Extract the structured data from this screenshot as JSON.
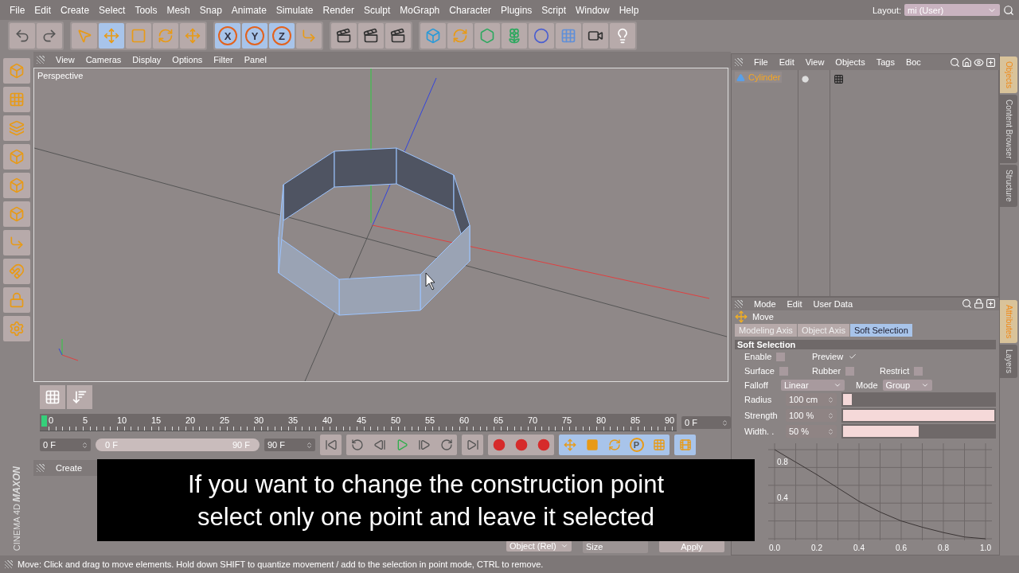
{
  "menu": [
    "File",
    "Edit",
    "Create",
    "Select",
    "Tools",
    "Mesh",
    "Snap",
    "Animate",
    "Simulate",
    "Render",
    "Sculpt",
    "MoGraph",
    "Character",
    "Plugins",
    "Script",
    "Window",
    "Help"
  ],
  "layout": {
    "label": "Layout:",
    "value": "mi (User)"
  },
  "toolbar": {
    "tools": [
      {
        "kind": "live-select",
        "selected": false
      },
      {
        "kind": "move",
        "selected": true
      },
      {
        "kind": "scale",
        "selected": false
      },
      {
        "kind": "rotate",
        "selected": false
      }
    ],
    "axis_locks": [
      {
        "label": "X",
        "on": true
      },
      {
        "label": "Y",
        "on": true
      },
      {
        "label": "Z",
        "on": true
      }
    ]
  },
  "viewport": {
    "menu": [
      "View",
      "Cameras",
      "Display",
      "Options",
      "Filter",
      "Panel"
    ],
    "label": "Perspective"
  },
  "timeline": {
    "ticks": [
      "0",
      "5",
      "10",
      "15",
      "20",
      "25",
      "30",
      "35",
      "40",
      "45",
      "50",
      "55",
      "60",
      "65",
      "70",
      "75",
      "80",
      "85",
      "90"
    ],
    "level": 0,
    "current": "0 F"
  },
  "transport": {
    "start": "0 F",
    "range": {
      "start": "0 F",
      "end": "90 F",
      "level": 1
    },
    "end": "90 F",
    "key_label": "P"
  },
  "materials": {
    "menu": [
      "Create"
    ]
  },
  "coordinates": {
    "space": "Object (Rel)",
    "field": "Size",
    "apply": "Apply"
  },
  "logo": {
    "brand": "MAXON",
    "product": "CINEMA 4D"
  },
  "caption": [
    "If you want to change the construction point",
    "select only one point and leave it selected"
  ],
  "status_bar": "Move: Click and drag to move elements. Hold down SHIFT to quantize movement / add to the selection in point mode, CTRL to remove.",
  "object_manager": {
    "menu": [
      "File",
      "Edit",
      "View",
      "Objects",
      "Tags",
      "Boc"
    ],
    "objects": [
      {
        "name": "Cylinder",
        "selected": true
      }
    ]
  },
  "side_tabs_top": [
    {
      "label": "Objects",
      "selected": true
    },
    {
      "label": "Content Browser",
      "selected": false
    },
    {
      "label": "Structure",
      "selected": false
    }
  ],
  "side_tabs_bottom": [
    {
      "label": "Attributes",
      "selected": true
    },
    {
      "label": "Layers",
      "selected": false
    }
  ],
  "attributes": {
    "menu": [
      "Mode",
      "Edit",
      "User Data"
    ],
    "title": "Move",
    "tabs": [
      {
        "label": "Modeling Axis",
        "selected": false
      },
      {
        "label": "Object Axis",
        "selected": false
      },
      {
        "label": "Soft Selection",
        "selected": true
      }
    ],
    "section": "Soft Selection",
    "checkbox_rows": [
      [
        {
          "label": "Enable",
          "checked": false
        },
        {
          "label": "Preview",
          "checked": true
        }
      ],
      [
        {
          "label": "Surface",
          "checked": false
        },
        {
          "label": "Rubber",
          "checked": false
        },
        {
          "label": "Restrict",
          "checked": false
        }
      ]
    ],
    "falloff": {
      "label": "Falloff",
      "value": "Linear"
    },
    "mode": {
      "label": "Mode",
      "value": "Group"
    },
    "sliders": [
      {
        "label": "Radius",
        "value": "100 cm",
        "level": 0.06
      },
      {
        "label": "Strength",
        "value": "100 %",
        "level": 1
      },
      {
        "label": "Width. .",
        "value": "50 %",
        "level": 0.5
      }
    ],
    "chart_data": {
      "type": "line",
      "x": [
        0,
        0.1,
        0.2,
        0.3,
        0.4,
        0.5,
        0.6,
        0.7,
        0.8,
        0.9,
        1.0
      ],
      "series": [
        {
          "color": "#3a3434",
          "values": [
            1,
            0.86,
            0.72,
            0.57,
            0.42,
            0.3,
            0.2,
            0.13,
            0.07,
            0.02,
            0
          ]
        }
      ],
      "xlim": [
        0,
        1
      ],
      "ylim": [
        0,
        1
      ],
      "xticks": [
        {
          "value": 0,
          "label": "0.0"
        },
        {
          "value": 0.2,
          "label": "0.2"
        },
        {
          "value": 0.4,
          "label": "0.4"
        },
        {
          "value": 0.6,
          "label": "0.6"
        },
        {
          "value": 0.8,
          "label": "0.8"
        },
        {
          "value": 1,
          "label": "1.0"
        }
      ],
      "yticks": [
        {
          "value": 0.4,
          "label": "0.4"
        },
        {
          "value": 0.8,
          "label": "0.8"
        }
      ],
      "grid": true
    }
  }
}
